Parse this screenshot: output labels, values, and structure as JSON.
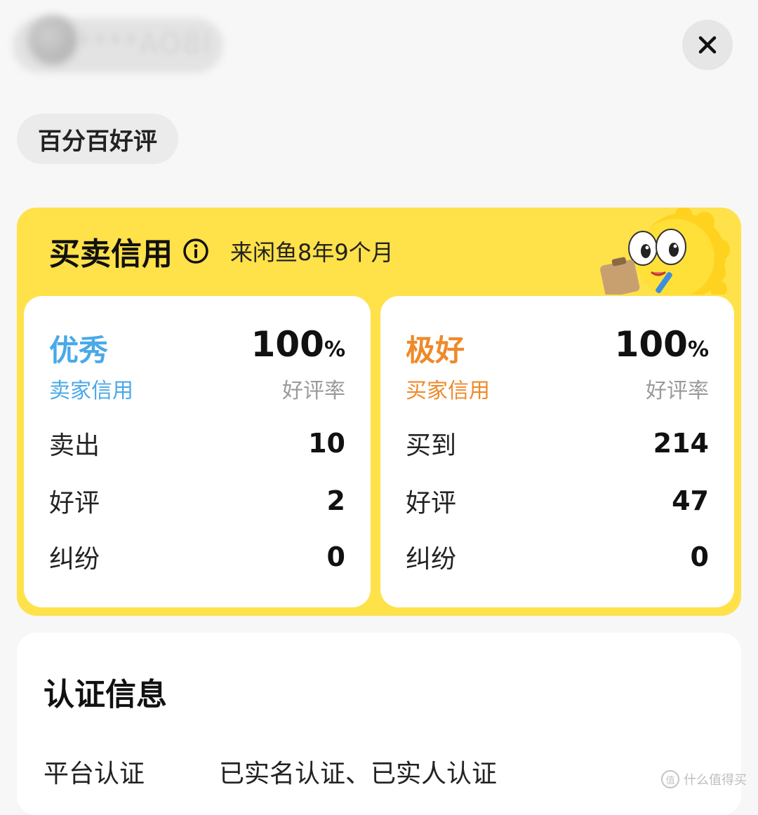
{
  "header": {
    "username": "****AO8I",
    "close_icon": "close-icon"
  },
  "tag": {
    "label": "百分百好评"
  },
  "credit": {
    "title": "买卖信用",
    "info_icon": "info-icon",
    "age": "来闲鱼8年9个月",
    "colors": {
      "card_bg": "#ffe14a",
      "seller_accent": "#4aa9e8",
      "buyer_accent": "#ee8a2a"
    },
    "seller": {
      "level": "优秀",
      "level_sub": "卖家信用",
      "rate_value": "100",
      "rate_unit": "%",
      "rate_label": "好评率",
      "stats": [
        {
          "label": "卖出",
          "value": "10"
        },
        {
          "label": "好评",
          "value": "2"
        },
        {
          "label": "纠纷",
          "value": "0"
        }
      ]
    },
    "buyer": {
      "level": "极好",
      "level_sub": "买家信用",
      "rate_value": "100",
      "rate_unit": "%",
      "rate_label": "好评率",
      "stats": [
        {
          "label": "买到",
          "value": "214"
        },
        {
          "label": "好评",
          "value": "47"
        },
        {
          "label": "纠纷",
          "value": "0"
        }
      ]
    }
  },
  "auth": {
    "title": "认证信息",
    "rows": [
      {
        "label": "平台认证",
        "value": "已实名认证、已实人认证"
      }
    ]
  },
  "watermark": {
    "text": "什么值得买",
    "icon": "值"
  }
}
